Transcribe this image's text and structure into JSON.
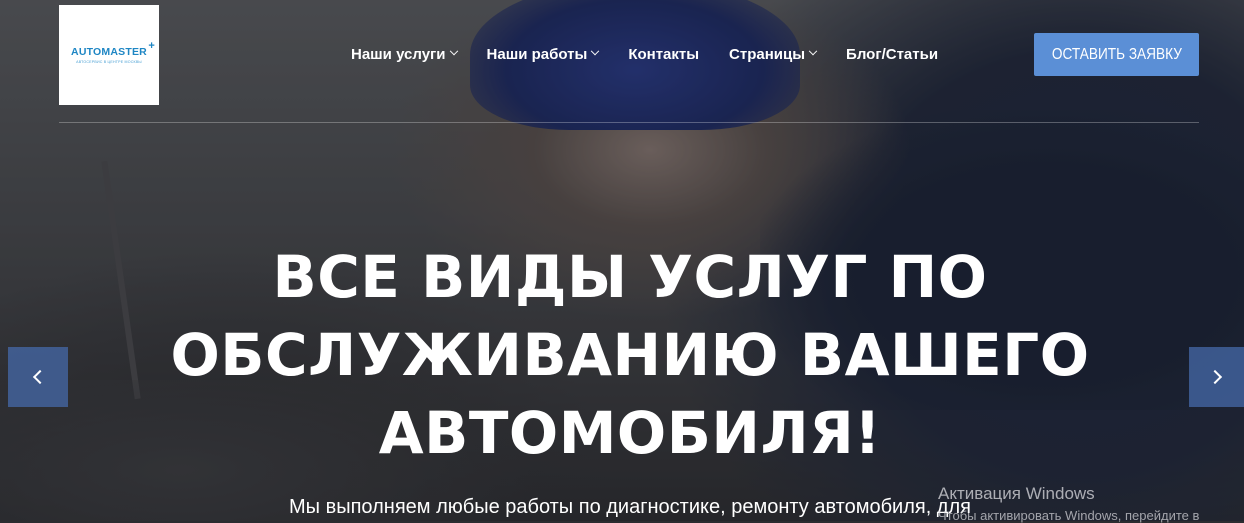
{
  "logo": {
    "name": "AUTOMASTER",
    "tagline": "АВТОСЕРВИС В ЦЕНТРЕ МОСКВЫ"
  },
  "nav": {
    "items": [
      {
        "label": "Наши услуги",
        "has_dropdown": true
      },
      {
        "label": "Наши работы",
        "has_dropdown": true
      },
      {
        "label": "Контакты",
        "has_dropdown": false
      },
      {
        "label": "Страницы",
        "has_dropdown": true
      },
      {
        "label": "Блог/Статьи",
        "has_dropdown": false
      }
    ],
    "cta_label": "ОСТАВИТЬ ЗАЯВКУ"
  },
  "hero": {
    "headline_line1": "ВСЕ ВИДЫ УСЛУГ ПО",
    "headline_line2": "ОБСЛУЖИВАНИЮ ВАШЕГО",
    "headline_line3": "АВТОМОБИЛЯ!",
    "subtext": "Мы выполняем любые работы по диагностике, ремонту автомобиля, для"
  },
  "slider": {
    "prev_icon": "chevron-left-icon",
    "next_icon": "chevron-right-icon"
  },
  "windows_watermark": {
    "title": "Активация Windows",
    "subtitle": "Чтобы активировать Windows, перейдите в"
  },
  "colors": {
    "accent": "#5b8fd6",
    "logo_blue": "#1e86c4",
    "arrow_bg": "#4669aa"
  }
}
